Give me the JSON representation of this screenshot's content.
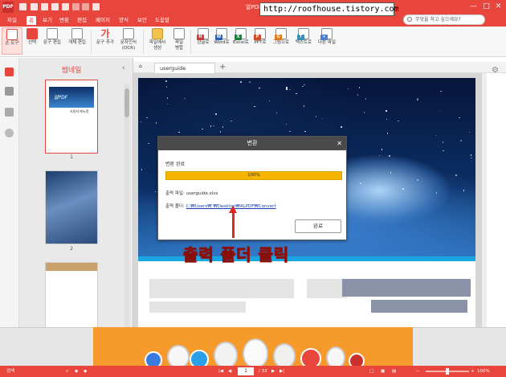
{
  "titlebar": {
    "app_title": "알PDF",
    "logo_text": "PDF",
    "watermark": "http://roofhouse.tistory.com",
    "help_search_placeholder": "무엇을 하고 싶으세요?",
    "buttons": {
      "minimize": "—",
      "maximize": "□",
      "close": "✕"
    }
  },
  "menu": {
    "items": [
      "파일",
      "홈",
      "보기",
      "변환",
      "편집",
      "페이지",
      "양식",
      "보안",
      "도움말"
    ],
    "active_index": 1
  },
  "ribbon": {
    "items": [
      {
        "label": "손 도구",
        "icon": "hand-icon",
        "selected": true
      },
      {
        "label": "선택",
        "icon": "select-text-icon",
        "selected": false
      },
      {
        "label": "문구 편집",
        "icon": "edit-text-icon",
        "selected": false
      },
      {
        "label": "개체 편집",
        "icon": "edit-object-icon",
        "selected": false
      },
      {
        "label": "문구 추가",
        "icon": "add-text-icon",
        "glyph": "가",
        "selected": false
      },
      {
        "label": "문자인식\n(OCR)",
        "icon": "ocr-icon",
        "selected": false
      },
      {
        "label": "파일에서\n생성",
        "icon": "folder-icon",
        "selected": false
      },
      {
        "label": "파일\n병합",
        "icon": "merge-icon",
        "selected": false
      },
      {
        "label": "한글로",
        "icon": "hwp-icon",
        "tag": "H",
        "tag_color": "#d4373b"
      },
      {
        "label": "Word로",
        "icon": "word-icon",
        "tag": "W",
        "tag_color": "#2b5fb8"
      },
      {
        "label": "Excel로",
        "icon": "excel-icon",
        "tag": "X",
        "tag_color": "#1f7a3e"
      },
      {
        "label": "PPT로",
        "icon": "ppt-icon",
        "tag": "P",
        "tag_color": "#d24b26"
      },
      {
        "label": "그림으로",
        "icon": "image-icon",
        "tag": "G",
        "tag_color": "#e07b16"
      },
      {
        "label": "텍스트로",
        "icon": "text-icon",
        "tag": "T",
        "tag_color": "#3a8fb7"
      },
      {
        "label": "다른 파일",
        "icon": "other-file-icon",
        "tag": "▾",
        "tag_color": "#4a7fd0"
      }
    ]
  },
  "thumbnails": {
    "title": "썸네일",
    "pages": [
      {
        "label": "1",
        "current": true,
        "title_text": "알PDF",
        "subtitle_text": "사용자 매뉴얼"
      },
      {
        "label": "2",
        "current": false
      },
      {
        "label": "",
        "current": false
      }
    ]
  },
  "tabs": {
    "document_tab": "userguide",
    "add_tab": "+"
  },
  "dialog": {
    "title": "변환",
    "close": "✕",
    "status": "변환 완료",
    "progress_percent": 100,
    "progress_label": "100%",
    "output_file_label": "출력 파일: userguide.xlsx",
    "output_folder_label": "출력 폴더:",
    "output_folder_link": "C:₩Users₩        ₩Desktop₩ALPDF₩Convert",
    "ok_button": "완료"
  },
  "annotation": {
    "text": "출력 폴더 클릭",
    "color": "#e0261d"
  },
  "statusbar": {
    "left_label": "검색",
    "page_current": "1",
    "page_total": "/ 33",
    "zoom": "100%",
    "nav": {
      "first": "|◀",
      "prev": "◀",
      "next": "▶",
      "last": "▶|"
    }
  },
  "colors": {
    "brand": "#e8453c",
    "progress": "#f5b400",
    "link": "#1a3fb3"
  }
}
